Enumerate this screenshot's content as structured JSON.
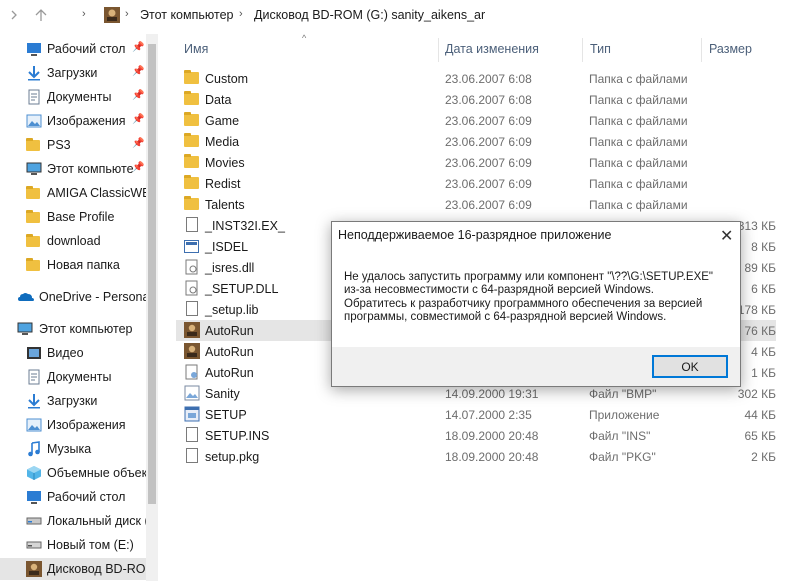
{
  "address": {
    "breadcrumbs": [
      "Этот компьютер",
      "Дисковод BD-ROM (G:) sanity_aikens_ar"
    ]
  },
  "sidebar": {
    "quick_access": [
      {
        "label": "Рабочий стол",
        "icon": "desktop-icon",
        "pinned": true
      },
      {
        "label": "Загрузки",
        "icon": "download-arrow-icon",
        "pinned": true
      },
      {
        "label": "Документы",
        "icon": "documents-icon",
        "pinned": true
      },
      {
        "label": "Изображения",
        "icon": "pictures-icon",
        "pinned": true
      },
      {
        "label": "PS3",
        "icon": "folder-icon",
        "pinned": true
      },
      {
        "label": "Этот компьюте",
        "icon": "computer-icon",
        "pinned": true
      },
      {
        "label": "AMIGA ClassicWB-",
        "icon": "folder-icon",
        "pinned": false
      },
      {
        "label": "Base Profile",
        "icon": "folder-icon",
        "pinned": false
      },
      {
        "label": "download",
        "icon": "folder-icon",
        "pinned": false
      },
      {
        "label": "Новая папка",
        "icon": "folder-icon",
        "pinned": false
      }
    ],
    "onedrive": "OneDrive - Personal",
    "this_pc": "Этот компьютер",
    "pc_items": [
      {
        "label": "Видео",
        "icon": "video-icon"
      },
      {
        "label": "Документы",
        "icon": "documents-icon"
      },
      {
        "label": "Загрузки",
        "icon": "download-arrow-icon"
      },
      {
        "label": "Изображения",
        "icon": "pictures-icon"
      },
      {
        "label": "Музыка",
        "icon": "music-icon"
      },
      {
        "label": "Объемные объект",
        "icon": "3d-objects-icon"
      },
      {
        "label": "Рабочий стол",
        "icon": "desktop-icon"
      },
      {
        "label": "Локальный диск (",
        "icon": "drive-icon"
      },
      {
        "label": "Новый том (E:)",
        "icon": "drive-icon"
      },
      {
        "label": "Дисковод BD-ROM",
        "icon": "bd-rom-drive-icon"
      }
    ]
  },
  "columns": {
    "name": "Имя",
    "date": "Дата изменения",
    "type": "Тип",
    "size": "Размер"
  },
  "files": [
    {
      "name": "Custom",
      "date": "23.06.2007 6:08",
      "type": "Папка с файлами",
      "size": "",
      "icon": "folder-icon"
    },
    {
      "name": "Data",
      "date": "23.06.2007 6:08",
      "type": "Папка с файлами",
      "size": "",
      "icon": "folder-icon"
    },
    {
      "name": "Game",
      "date": "23.06.2007 6:09",
      "type": "Папка с файлами",
      "size": "",
      "icon": "folder-icon"
    },
    {
      "name": "Media",
      "date": "23.06.2007 6:09",
      "type": "Папка с файлами",
      "size": "",
      "icon": "folder-icon"
    },
    {
      "name": "Movies",
      "date": "23.06.2007 6:09",
      "type": "Папка с файлами",
      "size": "",
      "icon": "folder-icon"
    },
    {
      "name": "Redist",
      "date": "23.06.2007 6:09",
      "type": "Папка с файлами",
      "size": "",
      "icon": "folder-icon"
    },
    {
      "name": "Talents",
      "date": "23.06.2007 6:09",
      "type": "Папка с файлами",
      "size": "",
      "icon": "folder-icon"
    },
    {
      "name": "_INST32I.EX_",
      "date": "",
      "type": "",
      "size": "313 КБ",
      "icon": "file-icon"
    },
    {
      "name": "_ISDEL",
      "date": "",
      "type": "",
      "size": "8 КБ",
      "icon": "app-window-icon"
    },
    {
      "name": "_isres.dll",
      "date": "",
      "type": "",
      "size": "89 КБ",
      "icon": "dll-icon"
    },
    {
      "name": "_SETUP.DLL",
      "date": "",
      "type": "",
      "size": "6 КБ",
      "icon": "dll-icon"
    },
    {
      "name": "_setup.lib",
      "date": "",
      "type": "",
      "size": "178 КБ",
      "icon": "file-icon"
    },
    {
      "name": "AutoRun",
      "date": "",
      "type": "",
      "size": "76 КБ",
      "icon": "autorun-icon"
    },
    {
      "name": "AutoRun",
      "date": "",
      "type": "",
      "size": "4 КБ",
      "icon": "autorun-icon"
    },
    {
      "name": "AutoRun",
      "date": "",
      "type": "",
      "size": "1 КБ",
      "icon": "settings-file-icon"
    },
    {
      "name": "Sanity",
      "date": "14.09.2000 19:31",
      "type": "Файл \"BMP\"",
      "size": "302 КБ",
      "icon": "image-file-icon"
    },
    {
      "name": "SETUP",
      "date": "14.07.2000 2:35",
      "type": "Приложение",
      "size": "44 КБ",
      "icon": "setup-app-icon"
    },
    {
      "name": "SETUP.INS",
      "date": "18.09.2000 20:48",
      "type": "Файл \"INS\"",
      "size": "65 КБ",
      "icon": "file-icon"
    },
    {
      "name": "setup.pkg",
      "date": "18.09.2000 20:48",
      "type": "Файл \"PKG\"",
      "size": "2 КБ",
      "icon": "file-icon"
    }
  ],
  "dialog": {
    "title": "Неподдерживаемое 16-разрядное приложение",
    "message_lines": [
      "Не удалось запустить программу или компонент \"\\??\\G:\\SETUP.EXE\"",
      "из-за несовместимости с 64-разрядной версией Windows.",
      "Обратитесь к разработчику программного обеспечения за версией",
      "программы, совместимой с 64-разрядной версией Windows."
    ],
    "ok_label": "OK"
  },
  "colors": {
    "folder": "#f0c040",
    "selection": "#e5e5e5",
    "header_text": "#4c607a",
    "ok_border": "#0078d7"
  }
}
